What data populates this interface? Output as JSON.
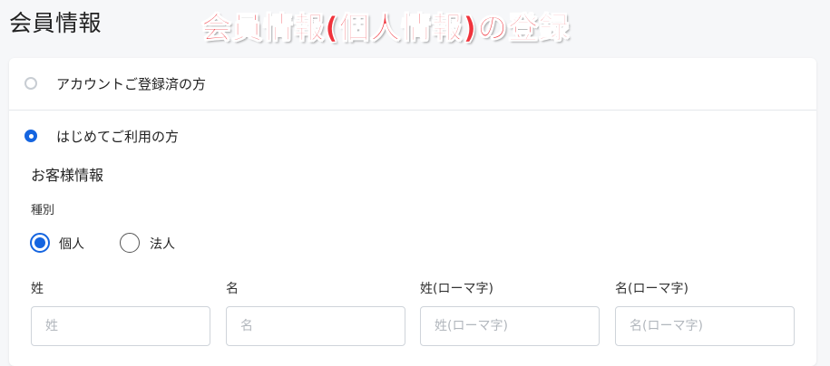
{
  "header": {
    "title": "会員情報",
    "banner": "会員情報(個人情報)の登録"
  },
  "options": {
    "existing_label": "アカウントご登録済の方",
    "existing_checked": false,
    "new_label": "はじめてご利用の方",
    "new_checked": true
  },
  "customer": {
    "section_title": "お客様情報",
    "type_label": "種別",
    "types": [
      {
        "label": "個人",
        "checked": true
      },
      {
        "label": "法人",
        "checked": false
      }
    ]
  },
  "fields": [
    {
      "label": "姓",
      "placeholder": "姓",
      "value": ""
    },
    {
      "label": "名",
      "placeholder": "名",
      "value": ""
    },
    {
      "label": "姓(ローマ字)",
      "placeholder": "姓(ローマ字)",
      "value": ""
    },
    {
      "label": "名(ローマ字)",
      "placeholder": "名(ローマ字)",
      "value": ""
    }
  ],
  "colors": {
    "accent": "#1565e0",
    "banner": "#f0333c"
  }
}
